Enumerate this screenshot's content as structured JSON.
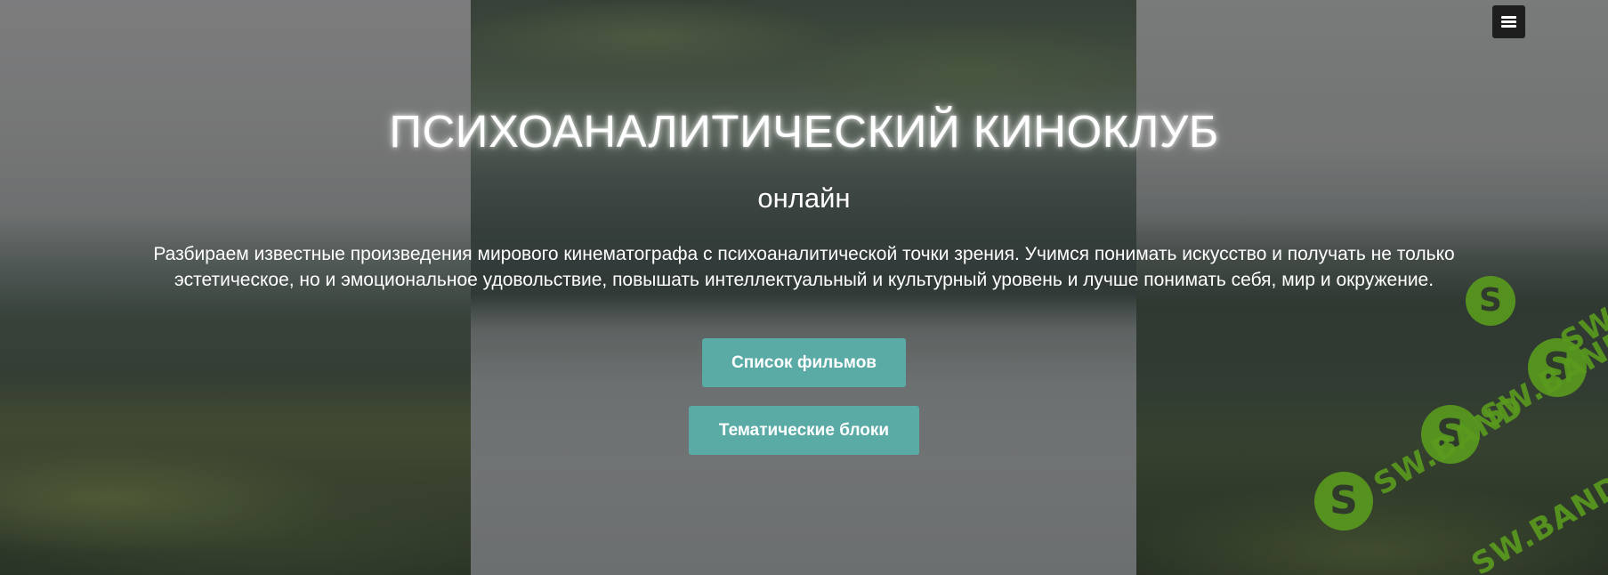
{
  "header": {
    "menu_icon": "hamburger-menu-icon"
  },
  "hero": {
    "title": "ПСИХОАНАЛИТИЧЕСКИЙ КИНОКЛУБ",
    "subtitle": "онлайн",
    "description": "Разбираем известные произведения мирового кинематографа с психоаналитической точки зрения. Учимся понимать искусство и получать не только эстетическое, но и эмоциональное удовольствие, повышать интеллектуальный и культурный уровень и лучше понимать себя, мир и окружение.",
    "buttons": [
      {
        "label": "Список фильмов"
      },
      {
        "label": "Тематические блоки"
      }
    ]
  },
  "watermark": {
    "text": "SW.BAND",
    "logo_letter": "S"
  },
  "colors": {
    "button_bg": "#5aaba6",
    "menu_bg": "#1e1e1e",
    "watermark": "#5a9b1e",
    "text": "#ffffff"
  }
}
